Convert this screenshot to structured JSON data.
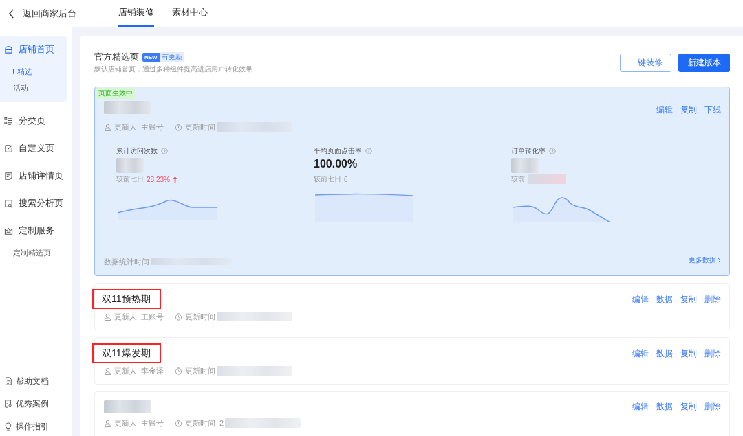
{
  "topbar": {
    "back": "返回商家后台",
    "tabs": [
      {
        "label": "店铺装修",
        "selected": true
      },
      {
        "label": "素材中心",
        "selected": false
      }
    ]
  },
  "sidebar": {
    "items": [
      {
        "label": "店铺首页",
        "kind": "store",
        "selected": true,
        "children": [
          {
            "label": "精选",
            "selected": true
          },
          {
            "label": "活动",
            "selected": false
          }
        ]
      },
      {
        "label": "分类页",
        "kind": "list",
        "selected": false
      },
      {
        "label": "自定义页",
        "kind": "edit",
        "selected": false
      },
      {
        "label": "店铺详情页",
        "kind": "note",
        "selected": false
      },
      {
        "label": "搜索分析页",
        "kind": "search",
        "selected": false
      },
      {
        "label": "定制服务",
        "kind": "crown",
        "selected": false,
        "children": [
          {
            "label": "定制精选页",
            "selected": false
          }
        ]
      }
    ],
    "footer": [
      {
        "label": "帮助文档",
        "kind": "doc"
      },
      {
        "label": "优秀案例",
        "kind": "case"
      },
      {
        "label": "操作指引",
        "kind": "bulb"
      }
    ]
  },
  "page": {
    "title": "官方精选页",
    "badge": "NEW",
    "badge_text": "有更新",
    "description": "默认店铺首页，通过多种组件提高进店用户转化效果",
    "buttons": [
      {
        "label": "一键装修",
        "kind": "outline"
      },
      {
        "label": "新建版本",
        "kind": "primary"
      }
    ]
  },
  "active_version": {
    "status": "页面生效中",
    "updater_label": "更新人",
    "updater": "主账号",
    "time_label": "更新时间",
    "actions": [
      "编辑",
      "复制",
      "下线"
    ],
    "metrics": [
      {
        "label": "累计访问次数",
        "compare_label": "较前七日",
        "change": "28.23%",
        "kind": "rise"
      },
      {
        "label": "平均页面点击率",
        "value": "100.00%",
        "compare_label": "较前七日",
        "change": "0",
        "kind": "flat"
      },
      {
        "label": "订单转化率",
        "compare_label": "较前"
      }
    ],
    "stats_time_label": "数据统计时间",
    "more": "更多数据"
  },
  "versions": [
    {
      "title": "双11预热期",
      "highlighted": true,
      "updater_label": "更新人",
      "updater": "主账号",
      "time_label": "更新时间",
      "actions": [
        "编辑",
        "数据",
        "复制",
        "删除"
      ]
    },
    {
      "title": "双11爆发期",
      "highlighted": true,
      "updater_label": "更新人",
      "updater": "李金泽",
      "time_label": "更新时间",
      "actions": [
        "编辑",
        "数据",
        "复制",
        "删除"
      ]
    },
    {
      "highlighted": false,
      "updater_label": "更新人",
      "updater": "主账号",
      "time_label": "更新时间",
      "time": "2",
      "actions": [
        "编辑",
        "数据",
        "复制",
        "删除"
      ]
    }
  ]
}
